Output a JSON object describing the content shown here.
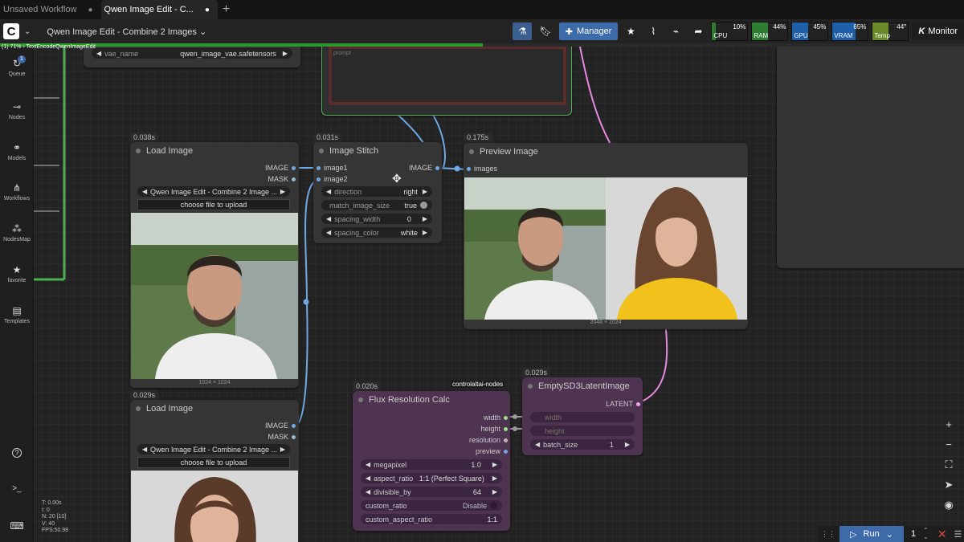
{
  "tabs": [
    {
      "label": "Unsaved Workflow",
      "modified": "●"
    },
    {
      "label": "Qwen Image Edit - C...",
      "modified": "●"
    }
  ],
  "new_tab": "+",
  "toolbar": {
    "workflow_name": "Qwen Image Edit - Combine 2 Images",
    "manager_label": "Manager",
    "monitor_label": "Monitor",
    "stats": [
      {
        "label": "CPU",
        "value": "10%",
        "fill": 0.1,
        "color": "#2e7d32"
      },
      {
        "label": "RAM",
        "value": "44%",
        "fill": 0.44,
        "color": "#2e7d32"
      },
      {
        "label": "GPU",
        "value": "45%",
        "fill": 0.45,
        "color": "#1e5fa8"
      },
      {
        "label": "VRAM",
        "value": "65%",
        "fill": 0.65,
        "color": "#1e5fa8"
      },
      {
        "label": "Temp",
        "value": "44°",
        "fill": 0.44,
        "color": "#6a8a2a"
      }
    ]
  },
  "progress": {
    "text": "(1) 71% › TextEncodeQwenImageEdit",
    "fraction": 0.71
  },
  "sidebar": {
    "items": [
      {
        "label": "Queue",
        "icon": "queue-icon",
        "glyph": "↻",
        "badge": "1"
      },
      {
        "label": "Nodes",
        "icon": "nodes-icon",
        "glyph": "⊸"
      },
      {
        "label": "Models",
        "icon": "models-icon",
        "glyph": "⚭"
      },
      {
        "label": "Workflows",
        "icon": "workflows-icon",
        "glyph": "⋔"
      },
      {
        "label": "NodesMap",
        "icon": "nodesmap-icon",
        "glyph": "⁂"
      },
      {
        "label": "favorite",
        "icon": "star-icon",
        "glyph": "★"
      },
      {
        "label": "Templates",
        "icon": "templates-icon",
        "glyph": "▤"
      }
    ],
    "bottom": [
      {
        "icon": "help-icon",
        "glyph": "?"
      },
      {
        "icon": "terminal-icon",
        "glyph": ">_"
      },
      {
        "icon": "keyboard-icon",
        "glyph": "⌨"
      }
    ]
  },
  "canvas": {
    "vae_widget": {
      "label": "vae_name",
      "value": "qwen_image_vae.safetensors"
    },
    "prompt_placeholder": "prompt",
    "load_image_1": {
      "timing": "0.038s",
      "title": "Load Image",
      "outputs": [
        "IMAGE",
        "MASK"
      ],
      "image_select": "Qwen Image Edit - Combine 2 Image ...",
      "upload_label": "choose file to upload",
      "dims": "1024 × 1024"
    },
    "load_image_2": {
      "timing": "0.029s",
      "title": "Load Image",
      "outputs": [
        "IMAGE",
        "MASK"
      ],
      "image_select": "Qwen Image Edit - Combine 2 Image ...",
      "upload_label": "choose file to upload"
    },
    "image_stitch": {
      "timing": "0.031s",
      "title": "Image Stitch",
      "inputs": [
        "image1",
        "image2"
      ],
      "output": "IMAGE",
      "widgets": [
        {
          "label": "direction",
          "value": "right"
        },
        {
          "label": "match_image_size",
          "value": "true"
        },
        {
          "label": "spacing_width",
          "value": "0"
        },
        {
          "label": "spacing_color",
          "value": "white"
        }
      ]
    },
    "preview_image": {
      "timing": "0.175s",
      "title": "Preview Image",
      "input": "images",
      "dims": "2048 × 1024"
    },
    "flux_calc": {
      "timing": "0.020s",
      "badge": "controlaltai-nodes",
      "title": "Flux Resolution Calc",
      "outputs": [
        "width",
        "height",
        "resolution",
        "preview"
      ],
      "widgets": [
        {
          "label": "megapixel",
          "value": "1.0"
        },
        {
          "label": "aspect_ratio",
          "value": "1:1 (Perfect Square)"
        },
        {
          "label": "divisible_by",
          "value": "64"
        },
        {
          "label": "custom_ratio",
          "value": "Disable"
        },
        {
          "label": "custom_aspect_ratio",
          "value": "1:1"
        }
      ]
    },
    "empty_latent": {
      "timing": "0.029s",
      "title": "EmptySD3LatentImage",
      "output": "LATENT",
      "inputs": [
        "width",
        "height"
      ],
      "widgets": [
        {
          "label": "batch_size",
          "value": "1"
        }
      ]
    },
    "stats": [
      "T: 0.00s",
      "I: 0",
      "N: 20 [10]",
      "V: 40",
      "FPS:50.98"
    ]
  },
  "run": {
    "label": "Run",
    "count": "1"
  }
}
